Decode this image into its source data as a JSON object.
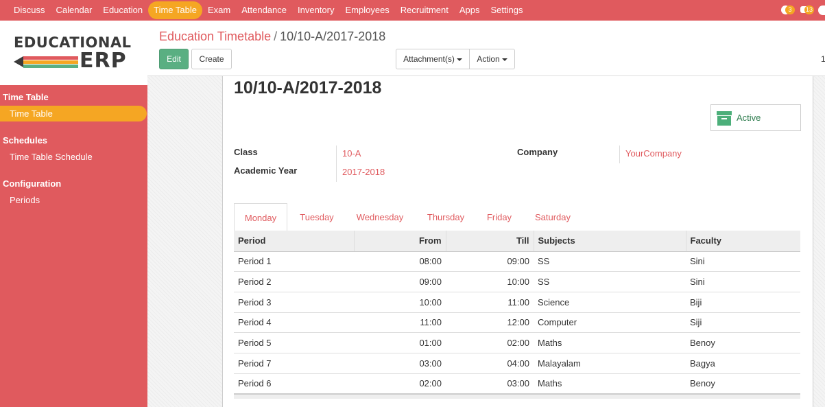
{
  "topbar": {
    "menu": [
      "Discuss",
      "Calendar",
      "Education",
      "Time Table",
      "Exam",
      "Attendance",
      "Inventory",
      "Employees",
      "Recruitment",
      "Apps",
      "Settings"
    ],
    "active_index": 3,
    "activity_count": "3",
    "message_count": "13",
    "accent_color": "#e05a5e",
    "highlight_color": "#f5a623"
  },
  "logo": {
    "line1": "EDUCATIONAL",
    "line2": "ERP"
  },
  "sidebar": {
    "sections": [
      {
        "title": "Time Table",
        "items": [
          "Time Table"
        ]
      },
      {
        "title": "Schedules",
        "items": [
          "Time Table Schedule"
        ]
      },
      {
        "title": "Configuration",
        "items": [
          "Periods"
        ]
      }
    ],
    "active_item": "Time Table"
  },
  "breadcrumb": {
    "parent": "Education Timetable",
    "separator": "/",
    "current": "10/10-A/2017-2018"
  },
  "buttons": {
    "edit": "Edit",
    "create": "Create",
    "attachments": "Attachment(s)",
    "action": "Action"
  },
  "pager_edge": "1",
  "record": {
    "title": "10/10-A/2017-2018",
    "status": "Active",
    "fields": {
      "class_label": "Class",
      "class_value": "10-A",
      "year_label": "Academic Year",
      "year_value": "2017-2018",
      "company_label": "Company",
      "company_value": "YourCompany"
    }
  },
  "tabs": [
    "Monday",
    "Tuesday",
    "Wednesday",
    "Thursday",
    "Friday",
    "Saturday"
  ],
  "active_tab": "Monday",
  "table": {
    "headers": [
      "Period",
      "From",
      "Till",
      "Subjects",
      "Faculty"
    ],
    "rows": [
      [
        "Period 1",
        "08:00",
        "09:00",
        "SS",
        "Sini"
      ],
      [
        "Period 2",
        "09:00",
        "10:00",
        "SS",
        "Sini"
      ],
      [
        "Period 3",
        "10:00",
        "11:00",
        "Science",
        "Biji"
      ],
      [
        "Period 4",
        "11:00",
        "12:00",
        "Computer",
        "Siji"
      ],
      [
        "Period 5",
        "01:00",
        "02:00",
        "Maths",
        "Benoy"
      ],
      [
        "Period 7",
        "03:00",
        "04:00",
        "Malayalam",
        "Bagya"
      ],
      [
        "Period 6",
        "02:00",
        "03:00",
        "Maths",
        "Benoy"
      ]
    ]
  }
}
